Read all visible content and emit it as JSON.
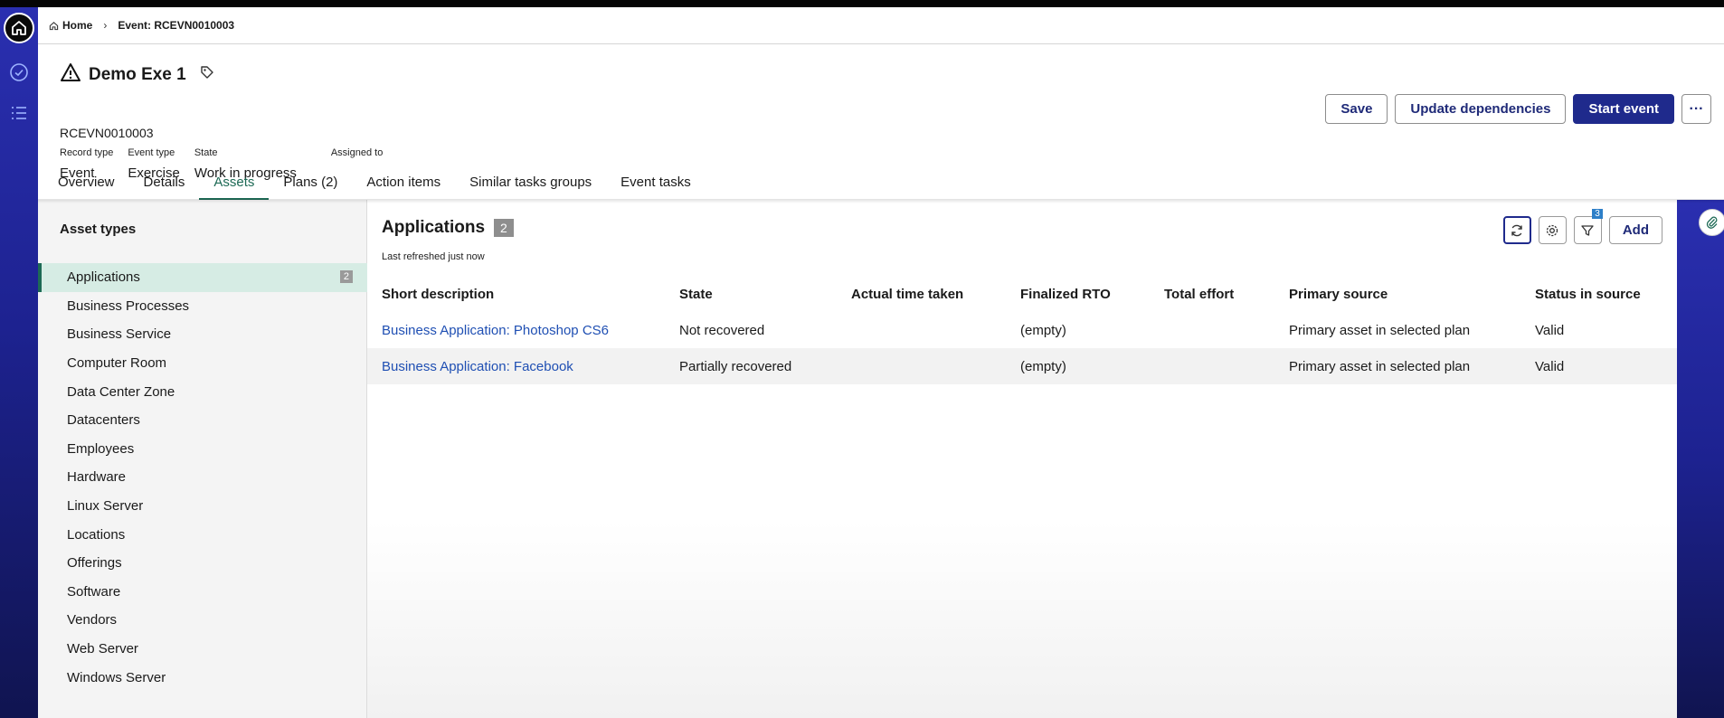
{
  "breadcrumb": {
    "home": "Home",
    "current": "Event: RCEVN0010003"
  },
  "record": {
    "title": "Demo Exe 1",
    "number": "RCEVN0010003",
    "fields": [
      {
        "label": "Record type",
        "value": "Event"
      },
      {
        "label": "Event type",
        "value": "Exercise"
      },
      {
        "label": "State",
        "value": "Work in progress"
      },
      {
        "label": "Assigned to",
        "value": ""
      }
    ]
  },
  "actions": {
    "save": "Save",
    "update": "Update dependencies",
    "start": "Start event",
    "more": "···"
  },
  "tabs": [
    "Overview",
    "Details",
    "Assets",
    "Plans (2)",
    "Action items",
    "Similar tasks groups",
    "Event tasks"
  ],
  "active_tab": "Assets",
  "asset_types": {
    "heading": "Asset types",
    "items": [
      {
        "label": "Applications",
        "count": "2"
      },
      {
        "label": "Business Processes"
      },
      {
        "label": "Business Service"
      },
      {
        "label": "Computer Room"
      },
      {
        "label": "Data Center Zone"
      },
      {
        "label": "Datacenters"
      },
      {
        "label": "Employees"
      },
      {
        "label": "Hardware"
      },
      {
        "label": "Linux Server"
      },
      {
        "label": "Locations"
      },
      {
        "label": "Offerings"
      },
      {
        "label": "Software"
      },
      {
        "label": "Vendors"
      },
      {
        "label": "Web Server"
      },
      {
        "label": "Windows Server"
      }
    ]
  },
  "list": {
    "title": "Applications",
    "count": "2",
    "refreshed": "Last refreshed just now",
    "filter_count": "3",
    "add": "Add",
    "columns": [
      "Short description",
      "State",
      "Actual time taken",
      "Finalized RTO",
      "Total effort",
      "Primary source",
      "Status in source"
    ],
    "rows": [
      [
        "Business Application: Photoshop CS6",
        "Not recovered",
        "",
        "(empty)",
        "",
        "Primary asset in selected plan",
        "Valid"
      ],
      [
        "Business Application: Facebook",
        "Partially recovered",
        "",
        "(empty)",
        "",
        "Primary asset in selected plan",
        "Valid"
      ]
    ]
  },
  "icons": {
    "rail": [
      "home-icon",
      "check-circle-icon",
      "list-icon"
    ],
    "title": [
      "warning-icon",
      "tag-icon"
    ],
    "tools": [
      "refresh-icon",
      "gear-icon",
      "filter-icon"
    ],
    "side": "paperclip-icon"
  },
  "colors": {
    "primary": "#1f2a8c",
    "active_tab": "#1d6a55",
    "link": "#1f4fb3",
    "rail": "#1d2290"
  }
}
